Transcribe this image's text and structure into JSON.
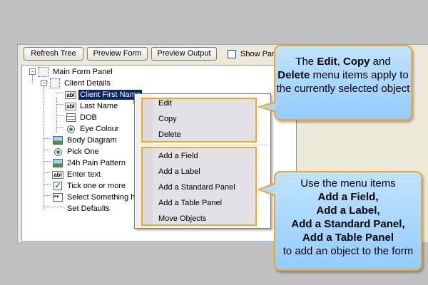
{
  "toolbar": {
    "refresh_tree": "Refresh Tree",
    "preview_form": "Preview Form",
    "preview_output": "Preview Output",
    "show_panel": "Show Par"
  },
  "tree": {
    "nodes": [
      {
        "label": "Main Form Panel",
        "icon": "panel-icon",
        "expander": "-"
      },
      {
        "label": "Client Details",
        "icon": "panel-icon",
        "expander": "-"
      },
      {
        "label": "Client First Name",
        "icon": "text-field-icon"
      },
      {
        "label": "Last Name",
        "icon": "text-field-icon"
      },
      {
        "label": "DOB",
        "icon": "date-grid-icon"
      },
      {
        "label": "Eye Colour",
        "icon": "radio-icon"
      },
      {
        "label": "Body Diagram",
        "icon": "image-icon"
      },
      {
        "label": "Pick One",
        "icon": "radio-icon"
      },
      {
        "label": "24h Pain Pattern",
        "icon": "image-icon"
      },
      {
        "label": "Enter text",
        "icon": "text-field-icon"
      },
      {
        "label": "Tick one or more",
        "icon": "checkbox-icon"
      },
      {
        "label": "Select Something h",
        "icon": "select-list-icon"
      },
      {
        "label": "Set Defaults",
        "icon": ""
      }
    ]
  },
  "context_menu": {
    "edit": "Edit",
    "copy": "Copy",
    "delete": "Delete",
    "add_field": "Add a Field",
    "add_label": "Add a Label",
    "add_standard_panel": "Add a Standard Panel",
    "add_table_panel": "Add a Table Panel",
    "move_objects": "Move Objects"
  },
  "callout1": {
    "t1": "The ",
    "edit": "Edit",
    "t2": ", ",
    "copy": "Copy",
    "t3": " and ",
    "delete": "Delete",
    "t4": " menu items apply to the currently selected object"
  },
  "callout2": {
    "intro": "Use the menu items",
    "l1": "Add a Field,",
    "l2": "Add a Label,",
    "l3": "Add a Standard Panel,",
    "l4": "Add a Table Panel",
    "outro": "to add an object to the form"
  },
  "colors": {
    "accent_orange": "#f5a623",
    "callout_blue": "#a8d6ff",
    "selection": "#0a246a"
  }
}
